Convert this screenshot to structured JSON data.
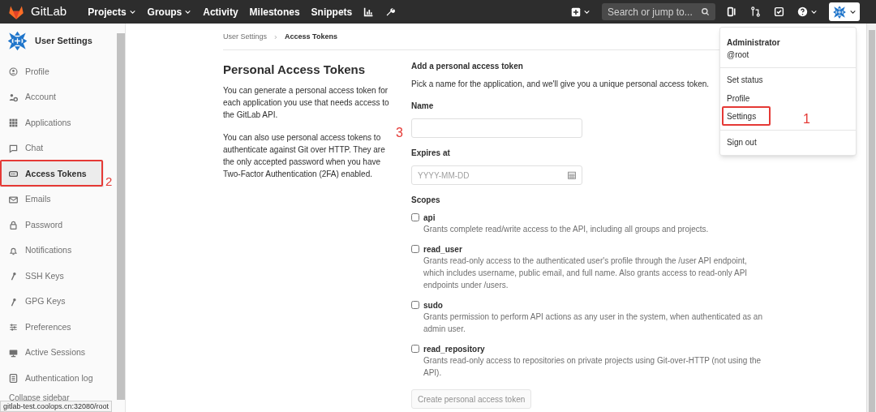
{
  "navbar": {
    "brand": "GitLab",
    "links": [
      {
        "label": "Projects",
        "dropdown": true
      },
      {
        "label": "Groups",
        "dropdown": true
      },
      {
        "label": "Activity",
        "dropdown": false
      },
      {
        "label": "Milestones",
        "dropdown": false
      },
      {
        "label": "Snippets",
        "dropdown": false
      }
    ],
    "search": {
      "placeholder": "Search or jump to..."
    }
  },
  "sidebar": {
    "title": "User Settings",
    "items": [
      {
        "label": "Profile",
        "selected": false
      },
      {
        "label": "Account",
        "selected": false
      },
      {
        "label": "Applications",
        "selected": false
      },
      {
        "label": "Chat",
        "selected": false
      },
      {
        "label": "Access Tokens",
        "selected": true,
        "annotation": "2"
      },
      {
        "label": "Emails",
        "selected": false
      },
      {
        "label": "Password",
        "selected": false
      },
      {
        "label": "Notifications",
        "selected": false
      },
      {
        "label": "SSH Keys",
        "selected": false
      },
      {
        "label": "GPG Keys",
        "selected": false
      },
      {
        "label": "Preferences",
        "selected": false
      },
      {
        "label": "Active Sessions",
        "selected": false
      },
      {
        "label": "Authentication log",
        "selected": false
      }
    ],
    "collapse": "Collapse sidebar"
  },
  "breadcrumb": [
    "User Settings",
    "Access Tokens"
  ],
  "intro": {
    "title": "Personal Access Tokens",
    "paragraphs": [
      "You can generate a personal access token for each application you use that needs access to the GitLab API.",
      "You can also use personal access tokens to authenticate against Git over HTTP. They are the only accepted password when you have Two-Factor Authentication (2FA) enabled."
    ]
  },
  "form": {
    "title": "Add a personal access token",
    "description": "Pick a name for the application, and we'll give you a unique personal access token.",
    "fields": [
      {
        "label": "Name",
        "kind": "text",
        "annotation": "3"
      },
      {
        "label": "Expires at",
        "placeholder": "YYYY-MM-DD",
        "kind": "date"
      }
    ],
    "scopes_label": "Scopes",
    "scopes": [
      {
        "name": "api",
        "checked": false,
        "description": "Grants complete read/write access to the API, including all groups and projects."
      },
      {
        "name": "read_user",
        "checked": false,
        "description": "Grants read-only access to the authenticated user's profile through the /user API endpoint, which includes username, public email, and full name. Also grants access to read-only API endpoints under /users."
      },
      {
        "name": "sudo",
        "checked": false,
        "description": "Grants permission to perform API actions as any user in the system, when authenticated as an admin user."
      },
      {
        "name": "read_repository",
        "checked": false,
        "description": "Grants read-only access to repositories on private projects using Git-over-HTTP (not using the API)."
      }
    ],
    "submit": {
      "label": "Create personal access token",
      "disabled": true
    }
  },
  "user_menu": {
    "name": "Administrator",
    "username": "@root",
    "groups": [
      {
        "items": [
          {
            "label": "Set status"
          },
          {
            "label": "Profile"
          },
          {
            "label": "Settings",
            "annotation": "1"
          }
        ]
      },
      {
        "items": [
          {
            "label": "Sign out"
          }
        ]
      }
    ]
  },
  "status_bar": {
    "url": "gitlab-test.coolops.cn:32080/root"
  }
}
